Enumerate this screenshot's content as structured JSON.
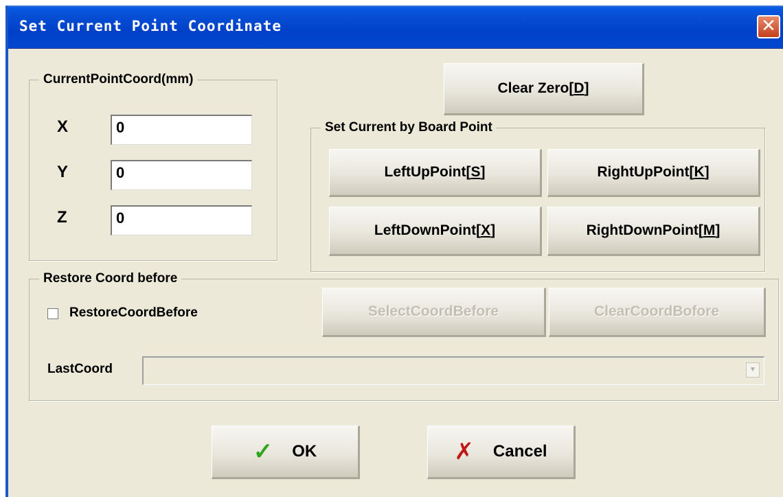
{
  "window": {
    "title": "Set Current Point Coordinate",
    "close_glyph": "✕"
  },
  "current_coord": {
    "group_label": "CurrentPointCoord(mm)",
    "x_label": "X",
    "x_value": "0",
    "y_label": "Y",
    "y_value": "0",
    "z_label": "Z",
    "z_value": "0"
  },
  "clear_zero": {
    "label": "Clear Zero",
    "hotkey": "D"
  },
  "board_point": {
    "group_label": "Set Current by Board Point",
    "left_up": {
      "label": "LeftUpPoint",
      "hotkey": "S"
    },
    "right_up": {
      "label": "RightUpPoint",
      "hotkey": "K"
    },
    "left_down": {
      "label": "LeftDownPoint",
      "hotkey": "X"
    },
    "right_down": {
      "label": "RightDownPoint",
      "hotkey": "M"
    }
  },
  "restore": {
    "group_label": "Restore Coord before",
    "checkbox_label": "RestoreCoordBefore",
    "checkbox_checked": false,
    "select_button": "SelectCoordBefore",
    "clear_button": "ClearCoordBofore",
    "last_coord_label": "LastCoord",
    "last_coord_value": ""
  },
  "footer": {
    "ok_label": "OK",
    "ok_icon": "checkmark-icon",
    "cancel_label": "Cancel",
    "cancel_icon": "x-icon"
  },
  "colors": {
    "titlebar": "#0040c8",
    "dialog_bg": "#ece9d8",
    "ok_icon": "#2fa51c",
    "cancel_icon": "#c01818"
  }
}
